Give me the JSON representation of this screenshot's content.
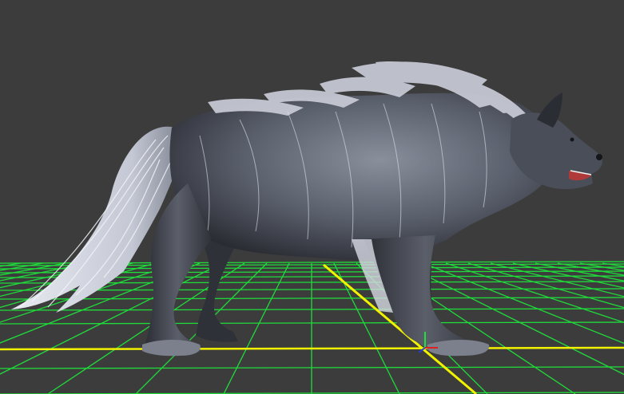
{
  "viewport": {
    "background_color": "#3c3c3c",
    "grid_color": "#1fdc3a",
    "axis_color": "#f2f200",
    "model": {
      "fur_dark_color": "#2a2c33",
      "fur_mid_color": "#6b7080",
      "fur_light_color": "#d8dbe6",
      "mouth_color": "#b03a3a"
    },
    "gizmo": {
      "x_axis_color": "#e02020",
      "y_axis_color": "#20e040",
      "z_axis_color": "#2040e0"
    }
  }
}
